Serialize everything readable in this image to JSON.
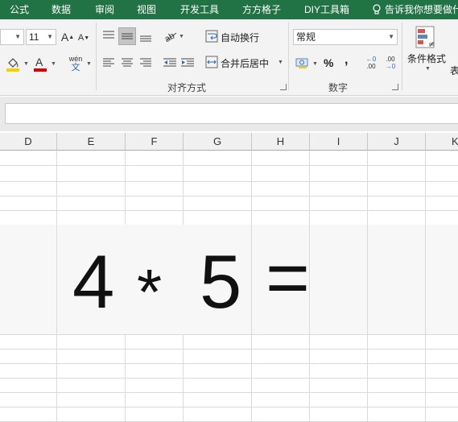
{
  "tabs": [
    "公式",
    "数据",
    "审阅",
    "视图",
    "开发工具",
    "方方格子",
    "DIY工具箱"
  ],
  "tell_me": "告诉我你想要做什",
  "ribbon": {
    "font_size": "11",
    "grow_font": "A",
    "shrink_font": "A",
    "phonetic_top": "wén",
    "phonetic_bottom": "文",
    "font_color_letter": "A",
    "wrap_text": "自动换行",
    "merge_center": "合并后居中",
    "number_format": "常规",
    "percent": "%",
    "comma": ",",
    "inc_decimal": ".00",
    "dec_decimal": ".00",
    "conditional_format": "条件格式",
    "table_format_partial": "表",
    "alignment_group": "对齐方式",
    "number_group": "数字"
  },
  "columns": [
    "D",
    "E",
    "F",
    "G",
    "H",
    "I",
    "J",
    "K"
  ],
  "cells": {
    "e_value": "4",
    "f_value": "*",
    "g_value": "5",
    "h_value": "="
  },
  "colors": {
    "tab_bar": "#217346",
    "ribbon_bg": "#f3f3f3",
    "highlight_yellow": "#f5d000",
    "font_red": "#e00000"
  }
}
